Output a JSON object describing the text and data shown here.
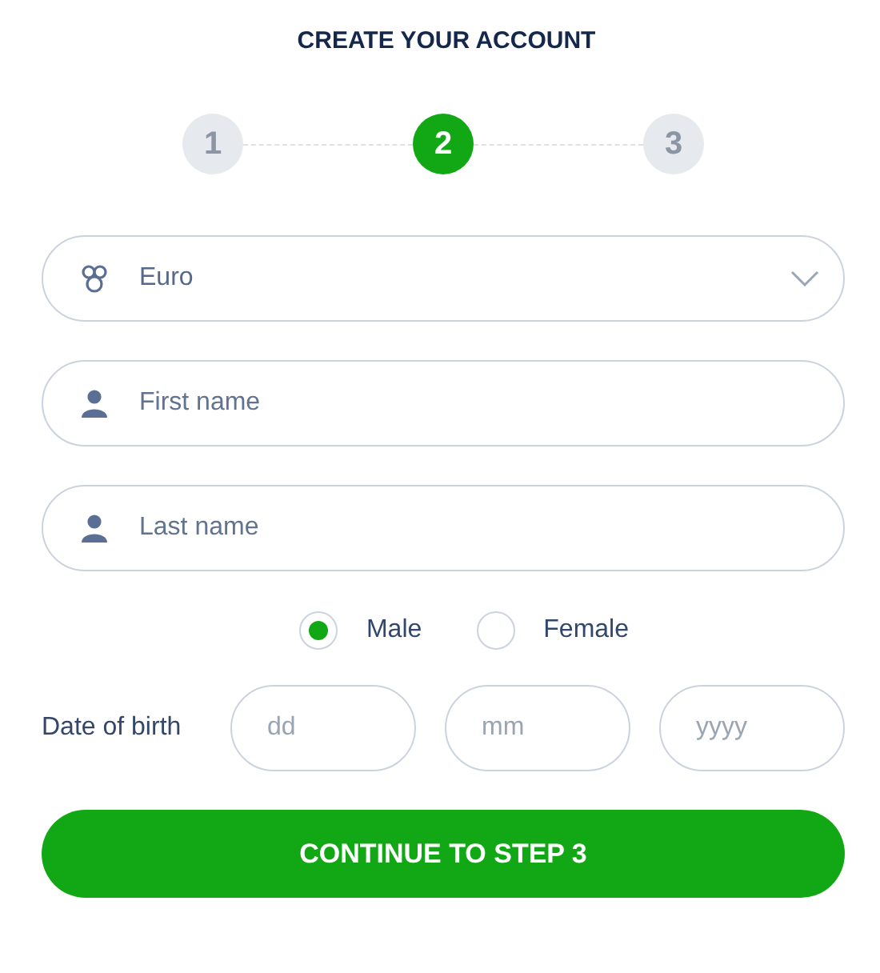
{
  "title": "CREATE YOUR ACCOUNT",
  "steps": [
    {
      "label": "1",
      "selected": false
    },
    {
      "label": "2",
      "selected": true
    },
    {
      "label": "3",
      "selected": false
    }
  ],
  "fields": [
    {
      "kind": "select",
      "value": "Euro"
    },
    {
      "kind": "text",
      "placeholder": "First name"
    },
    {
      "kind": "text",
      "placeholder": "Last name"
    }
  ],
  "gender": [
    {
      "label": "Male",
      "selected": true
    },
    {
      "label": "Female",
      "selected": false
    }
  ],
  "date_of_birth": {
    "label": "Date of birth",
    "fields": [
      {
        "placeholder": "dd"
      },
      {
        "placeholder": "mm"
      },
      {
        "placeholder": "yyyy"
      }
    ]
  },
  "submit_button": "CONTINUE TO STEP 3"
}
